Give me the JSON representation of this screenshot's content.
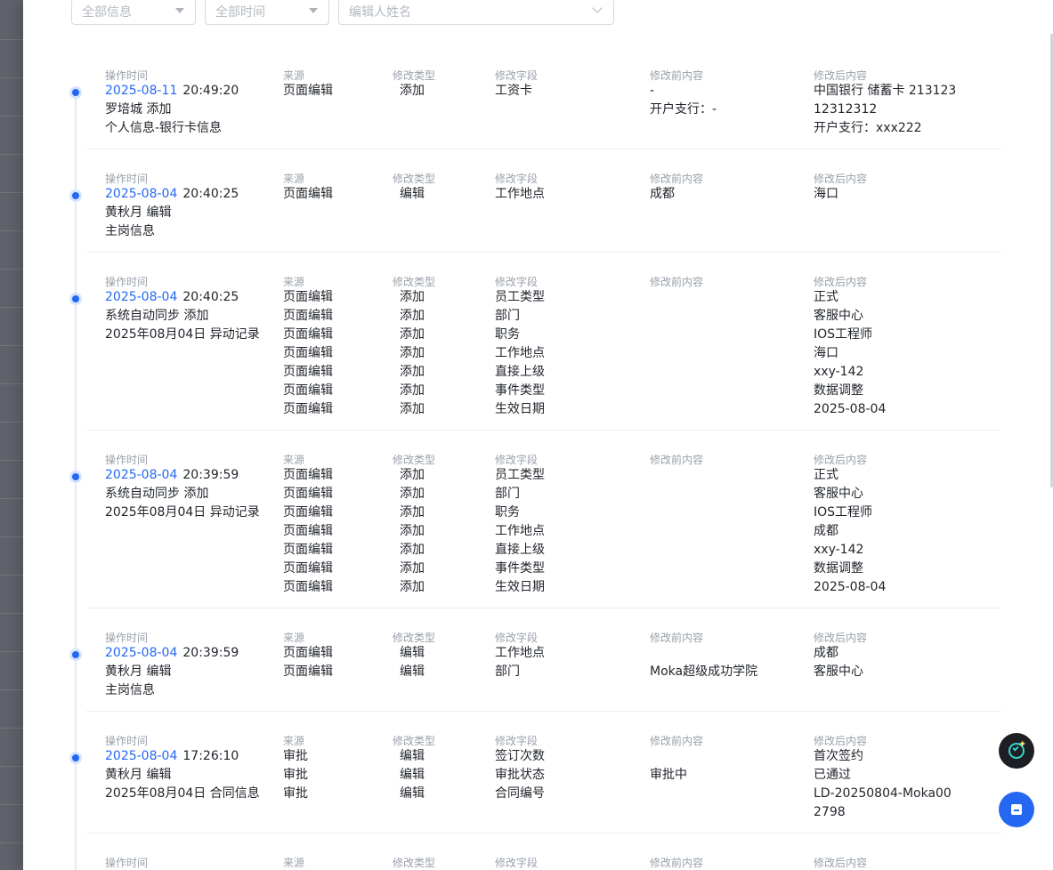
{
  "filters": {
    "info_placeholder": "全部信息",
    "time_placeholder": "全部时间",
    "editor_placeholder": "编辑人姓名"
  },
  "labels": {
    "op_time": "操作时间",
    "source": "来源",
    "mod_type": "修改类型",
    "mod_field": "修改字段",
    "before": "修改前内容",
    "after": "修改后内容"
  },
  "entries": [
    {
      "date": "2025-08-11",
      "time": "20:49:20",
      "actor": "罗培城 添加",
      "category": "个人信息-银行卡信息",
      "rows": [
        {
          "source": "页面编辑",
          "type": "添加",
          "field": "工资卡",
          "before": "-",
          "after": "中国银行 储蓄卡 213123"
        },
        {
          "source": "",
          "type": "",
          "field": "",
          "before": "开户支行：-",
          "after": "12312312"
        },
        {
          "source": "",
          "type": "",
          "field": "",
          "before": "",
          "after": "开户支行：xxx222"
        }
      ]
    },
    {
      "date": "2025-08-04",
      "time": "20:40:25",
      "actor": "黄秋月 编辑",
      "category": "主岗信息",
      "rows": [
        {
          "source": "页面编辑",
          "type": "编辑",
          "field": "工作地点",
          "before": "成都",
          "after": "海口"
        }
      ]
    },
    {
      "date": "2025-08-04",
      "time": "20:40:25",
      "actor": "系统自动同步 添加",
      "category": "2025年08月04日 异动记录",
      "rows": [
        {
          "source": "页面编辑",
          "type": "添加",
          "field": "员工类型",
          "before": "",
          "after": "正式"
        },
        {
          "source": "页面编辑",
          "type": "添加",
          "field": "部门",
          "before": "",
          "after": "客服中心"
        },
        {
          "source": "页面编辑",
          "type": "添加",
          "field": "职务",
          "before": "",
          "after": "IOS工程师"
        },
        {
          "source": "页面编辑",
          "type": "添加",
          "field": "工作地点",
          "before": "",
          "after": "海口"
        },
        {
          "source": "页面编辑",
          "type": "添加",
          "field": "直接上级",
          "before": "",
          "after": "xxy-142"
        },
        {
          "source": "页面编辑",
          "type": "添加",
          "field": "事件类型",
          "before": "",
          "after": "数据调整"
        },
        {
          "source": "页面编辑",
          "type": "添加",
          "field": "生效日期",
          "before": "",
          "after": "2025-08-04"
        }
      ]
    },
    {
      "date": "2025-08-04",
      "time": "20:39:59",
      "actor": "系统自动同步 添加",
      "category": "2025年08月04日 异动记录",
      "rows": [
        {
          "source": "页面编辑",
          "type": "添加",
          "field": "员工类型",
          "before": "",
          "after": "正式"
        },
        {
          "source": "页面编辑",
          "type": "添加",
          "field": "部门",
          "before": "",
          "after": "客服中心"
        },
        {
          "source": "页面编辑",
          "type": "添加",
          "field": "职务",
          "before": "",
          "after": "IOS工程师"
        },
        {
          "source": "页面编辑",
          "type": "添加",
          "field": "工作地点",
          "before": "",
          "after": "成都"
        },
        {
          "source": "页面编辑",
          "type": "添加",
          "field": "直接上级",
          "before": "",
          "after": "xxy-142"
        },
        {
          "source": "页面编辑",
          "type": "添加",
          "field": "事件类型",
          "before": "",
          "after": "数据调整"
        },
        {
          "source": "页面编辑",
          "type": "添加",
          "field": "生效日期",
          "before": "",
          "after": "2025-08-04"
        }
      ]
    },
    {
      "date": "2025-08-04",
      "time": "20:39:59",
      "actor": "黄秋月 编辑",
      "category": "主岗信息",
      "rows": [
        {
          "source": "页面编辑",
          "type": "编辑",
          "field": "工作地点",
          "before": "",
          "after": "成都"
        },
        {
          "source": "页面编辑",
          "type": "编辑",
          "field": "部门",
          "before": "Moka超级成功学院",
          "after": "客服中心"
        }
      ]
    },
    {
      "date": "2025-08-04",
      "time": "17:26:10",
      "actor": "黄秋月 编辑",
      "category": "2025年08月04日 合同信息",
      "rows": [
        {
          "source": "审批",
          "type": "编辑",
          "field": "签订次数",
          "before": "",
          "after": "首次签约"
        },
        {
          "source": "审批",
          "type": "编辑",
          "field": "审批状态",
          "before": "审批中",
          "after": "已通过"
        },
        {
          "source": "审批",
          "type": "编辑",
          "field": "合同编号",
          "before": "",
          "after": "LD-20250804-Moka00"
        },
        {
          "source": "",
          "type": "",
          "field": "",
          "before": "",
          "after": "2798"
        }
      ]
    },
    {
      "date": "",
      "time": "",
      "actor": "",
      "category": "",
      "rows": []
    }
  ]
}
